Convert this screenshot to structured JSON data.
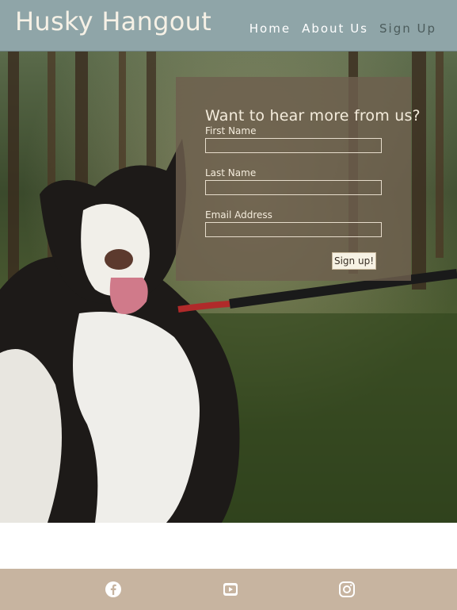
{
  "header": {
    "logo": "Husky Hangout",
    "nav": [
      {
        "label": "Home"
      },
      {
        "label": "About Us"
      },
      {
        "label": "Sign Up"
      }
    ]
  },
  "signup_form": {
    "title": "Want to hear more from us?",
    "fields": [
      {
        "label": "First Name",
        "value": ""
      },
      {
        "label": "Last Name",
        "value": ""
      },
      {
        "label": "Email Address",
        "value": ""
      }
    ],
    "submit_label": "Sign up!"
  },
  "footer": {
    "icons": [
      "facebook-icon",
      "youtube-icon",
      "instagram-icon"
    ]
  },
  "colors": {
    "header": "#8fa5a8",
    "footer": "#c7b4a0",
    "card": "#6e5f4e",
    "text_light": "#f4ecdc"
  }
}
